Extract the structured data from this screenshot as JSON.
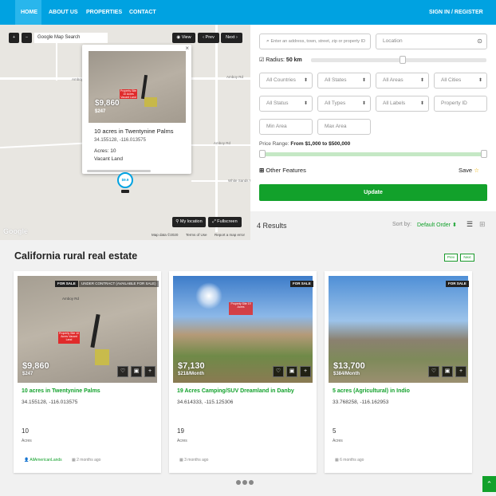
{
  "nav": {
    "items": [
      "HOME",
      "ABOUT US",
      "PROPERTIES",
      "CONTACT"
    ],
    "signin": "SIGN IN / REGISTER"
  },
  "map": {
    "zoom_in": "+",
    "zoom_out": "−",
    "search_label": "Google Map Search",
    "view_btn": "View",
    "prev_btn": "Prev",
    "next_btn": "Next",
    "my_location": "My location",
    "fullscreen": "Fullscreen",
    "google": "Google",
    "map_data": "Map data ©2020",
    "terms": "Terms of Use",
    "report": "Report a map error",
    "roads": [
      "Amboy Rd",
      "Amboy Rd",
      "White Sands Rd",
      "Amboy Rd"
    ],
    "marker": "$9.9",
    "info": {
      "price": "$9,860",
      "subprice": "$247",
      "title": "10 acres in Twentynine Palms",
      "coords": "34.155128, -116.013575",
      "acres": "Acres: 10",
      "type": "Vacant Land",
      "close": "×",
      "sign": "Property Site 10 Acres Vacant Land"
    }
  },
  "search": {
    "address_placeholder": "Enter an address, town, street, zip or property ID",
    "location_placeholder": "Location",
    "radius_label": "Radius:",
    "radius_value": "50 km",
    "selects_row1": [
      "All Countries",
      "All States",
      "All Areas",
      "All Cities"
    ],
    "selects_row2": [
      "All Status",
      "All Types",
      "All Labels"
    ],
    "property_id": "Property ID",
    "min_area": "Min Area",
    "max_area": "Max Area",
    "price_label": "Price Range:",
    "price_from": "From $1,000",
    "price_to": "to $500,000",
    "other_features": "Other Features",
    "save": "Save",
    "update": "Update"
  },
  "results": {
    "count": "4 Results",
    "sort_label": "Sort by:",
    "sort_value": "Default Order"
  },
  "section": {
    "title": "California rural real estate",
    "prev": "Prev",
    "next": "Next"
  },
  "cards": [
    {
      "badge1": "FOR SALE",
      "badge2": "UNDER CONTRACT (AVAILABLE FOR SALE)",
      "price": "$9,860",
      "subprice": "$247",
      "title": "10 acres in Twentynine Palms",
      "coords": "34.155128, -116.013575",
      "num": "10",
      "label": "Acres",
      "author": "AllAmericanLands",
      "date": "2 months ago",
      "road_label": "Amboy Rd",
      "sign": "Property Site 10 Acres Vacant Land"
    },
    {
      "badge1": "FOR SALE",
      "price": "$7,130",
      "subprice": "$218/Month",
      "title": "19 Acres Camping/SUV Dreamland in Danby",
      "coords": "34.614333, -115.125306",
      "num": "19",
      "label": "Acres",
      "date": "3 months ago",
      "sign": "Property Site 19 Acres"
    },
    {
      "badge1": "FOR SALE",
      "price": "$13,700",
      "subprice": "$384/Month",
      "title": "5 acres (Agricultural) in Indio",
      "coords": "33.768258, -116.162953",
      "num": "5",
      "label": "Acres",
      "date": "6 months ago"
    }
  ],
  "colors": {
    "nav": "#00a2e1",
    "accent_green": "#12a12b"
  }
}
